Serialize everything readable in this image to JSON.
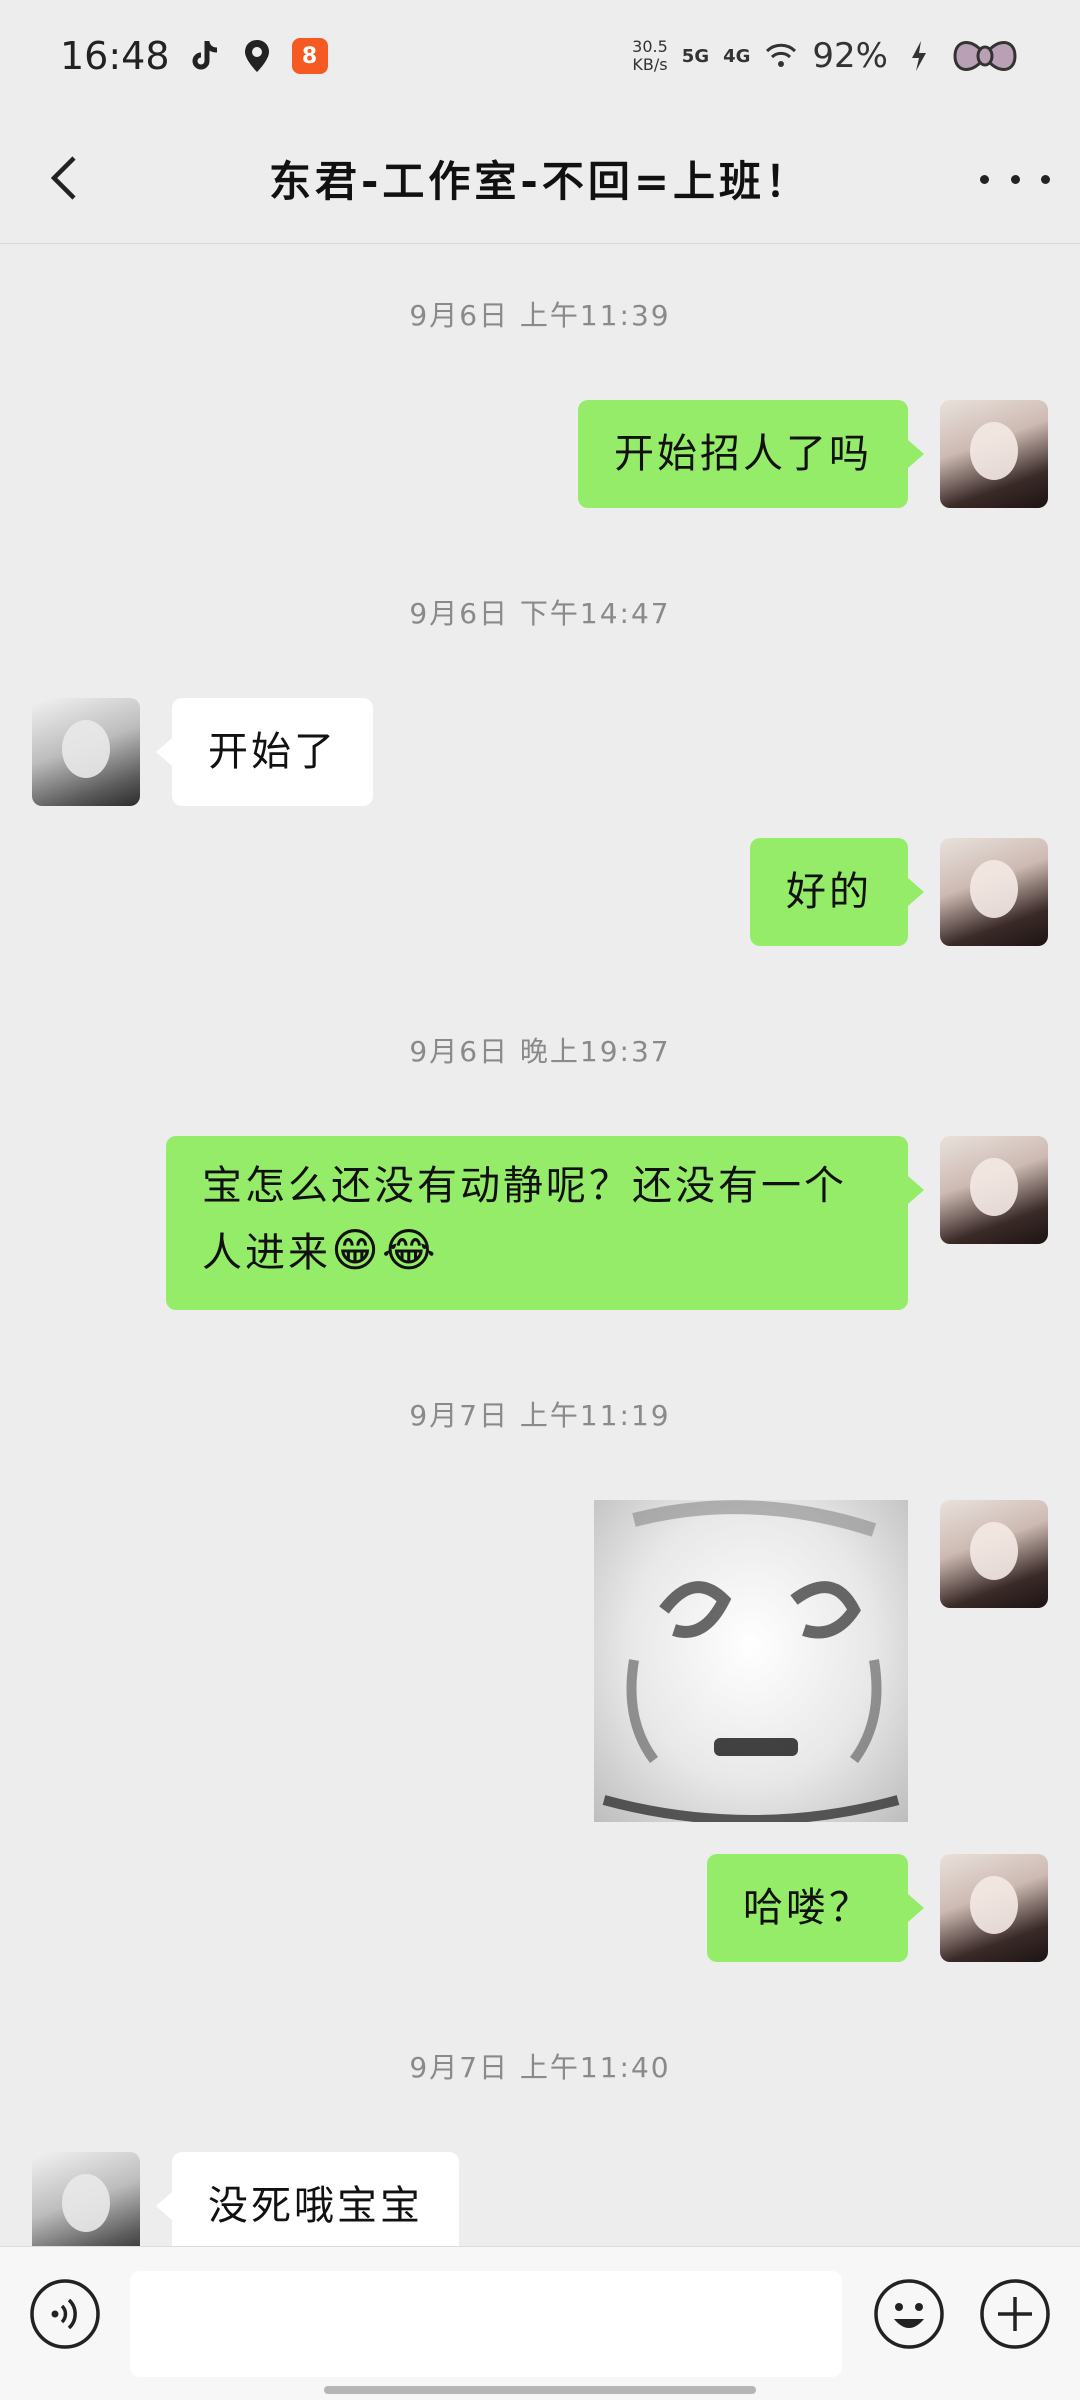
{
  "status_bar": {
    "time": "16:48",
    "net_speed_value": "30.5",
    "net_speed_unit": "KB/s",
    "net_tag_1": "5G",
    "net_tag_2": "4G",
    "battery": "92%",
    "app_badge": "8",
    "icons": [
      "tiktok-icon",
      "du-map-icon",
      "app-badge-icon",
      "wifi-icon",
      "charging-icon",
      "bow-icon"
    ]
  },
  "header": {
    "title": "东君-工作室-不回=上班！"
  },
  "messages": [
    {
      "type": "timestamp",
      "text": "9月6日 上午11:39"
    },
    {
      "type": "text",
      "from": "me",
      "text": "开始招人了吗"
    },
    {
      "type": "timestamp",
      "text": "9月6日 下午14:47"
    },
    {
      "type": "text",
      "from": "other",
      "text": "开始了"
    },
    {
      "type": "text",
      "from": "me",
      "text": "好的"
    },
    {
      "type": "timestamp",
      "text": "9月6日 晚上19:37"
    },
    {
      "type": "text",
      "from": "me",
      "line1": "宝怎么还没有动静呢？还没有一个",
      "line2": "人进来",
      "emojis": "😁😂"
    },
    {
      "type": "timestamp",
      "text": "9月7日 上午11:19"
    },
    {
      "type": "sticker",
      "from": "me",
      "icon": "sticker-image"
    },
    {
      "type": "text",
      "from": "me",
      "text": "哈喽？"
    },
    {
      "type": "timestamp",
      "text": "9月7日 上午11:40"
    },
    {
      "type": "text",
      "from": "other",
      "text": "没死哦宝宝"
    }
  ],
  "input_bar": {
    "text_value": "",
    "icons": [
      "voice-icon",
      "emoji-icon",
      "plus-icon"
    ]
  },
  "colors": {
    "background": "#ededed",
    "my_bubble": "#95ec69",
    "other_bubble": "#ffffff",
    "timestamp": "#8a8a8a"
  }
}
